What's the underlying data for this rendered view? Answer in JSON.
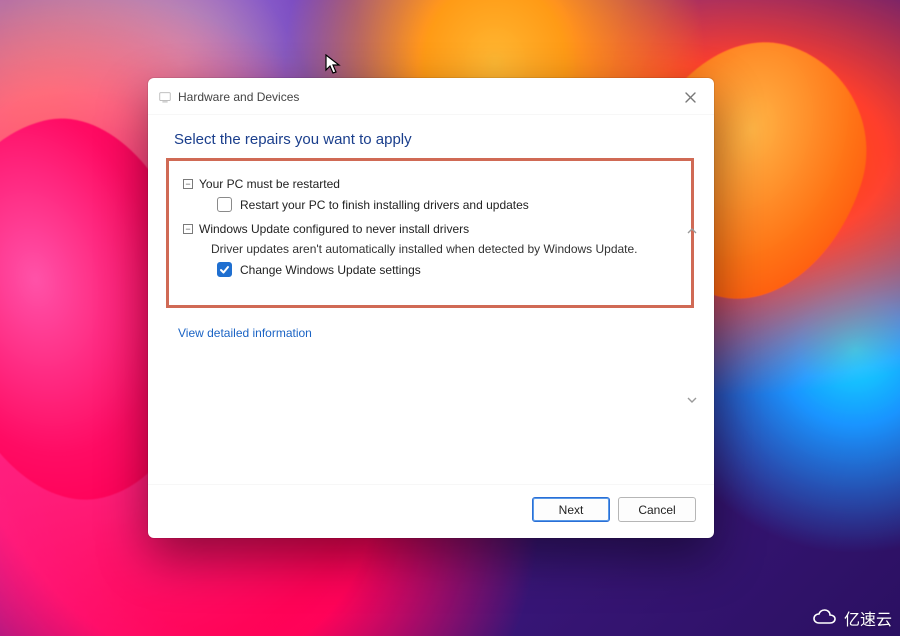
{
  "window": {
    "title": "Hardware and Devices"
  },
  "heading": "Select the repairs you want to apply",
  "groups": [
    {
      "title": "Your PC must be restarted",
      "description": "",
      "option": {
        "checked": false,
        "label": "Restart your PC to finish installing drivers and updates"
      }
    },
    {
      "title": "Windows Update configured to never install drivers",
      "description": "Driver updates aren't automatically installed when detected by Windows Update.",
      "option": {
        "checked": true,
        "label": "Change Windows Update settings"
      }
    }
  ],
  "link": "View detailed information",
  "buttons": {
    "next": "Next",
    "cancel": "Cancel"
  },
  "highlight_color": "#d06a55",
  "watermark": "亿速云"
}
